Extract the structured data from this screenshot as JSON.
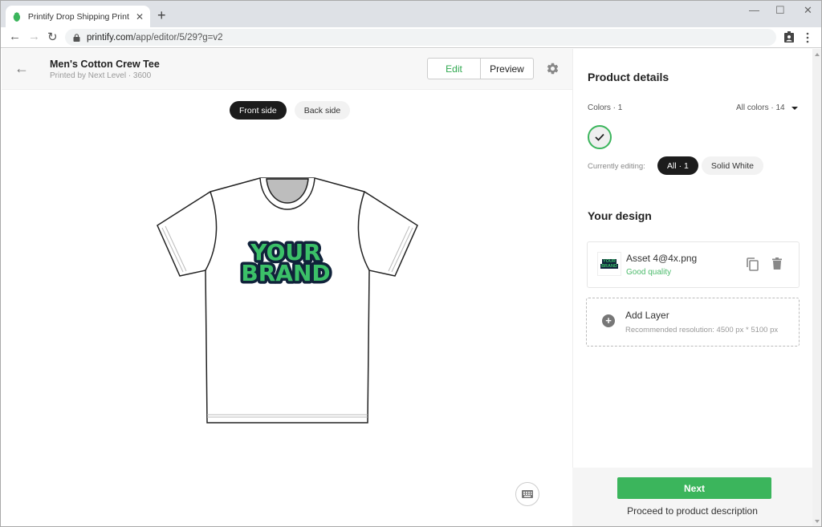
{
  "browser": {
    "tab_title": "Printify Drop Shipping Print on D",
    "url_domain": "printify.com",
    "url_path": "/app/editor/5/29?g=v2",
    "icons": {
      "favicon": "printify-leaf-icon",
      "close": "close-icon",
      "new_tab": "plus-icon",
      "back": "arrow-left-icon",
      "forward": "arrow-right-icon",
      "reload": "reload-icon",
      "lock": "lock-icon",
      "profile": "profile-icon",
      "menu": "kebab-menu-icon",
      "minimize": "minimize-icon",
      "maximize": "maximize-icon",
      "window_close": "window-close-icon"
    },
    "glyphs": {
      "close": "✕",
      "new_tab": "+",
      "back": "←",
      "forward": "→",
      "reload": "↻",
      "minimize": "—",
      "maximize": "☐",
      "window_close": "✕",
      "menu": "⋮"
    }
  },
  "header": {
    "back_glyph": "←",
    "title": "Men's Cotton Crew Tee",
    "subtitle": "Printed by Next Level · 3600",
    "edit_label": "Edit",
    "preview_label": "Preview"
  },
  "canvas": {
    "front_label": "Front side",
    "back_label": "Back side",
    "design_text_line1": "YOUR",
    "design_text_line2": "BRAND",
    "design_colors": {
      "fill": "#3bc068",
      "outline": "#10223a"
    }
  },
  "panel": {
    "product_details_title": "Product details",
    "colors_label": "Colors · 1",
    "all_colors_label": "All colors · 14",
    "currently_editing_label": "Currently editing:",
    "editing_all": "All · 1",
    "editing_color": "Solid White",
    "your_design_title": "Your design",
    "asset": {
      "name": "Asset 4@4x.png",
      "quality": "Good quality",
      "thumb_line1": "YOUR",
      "thumb_line2": "BRAND"
    },
    "add_layer": {
      "title": "Add Layer",
      "subtitle": "Recommended resolution: 4500 px * 5100 px",
      "plus": "+"
    },
    "next_label": "Next",
    "proceed_label": "Proceed to product description"
  },
  "colors": {
    "accent_green": "#3bb55c",
    "dark_pill": "#1c1c1c"
  }
}
